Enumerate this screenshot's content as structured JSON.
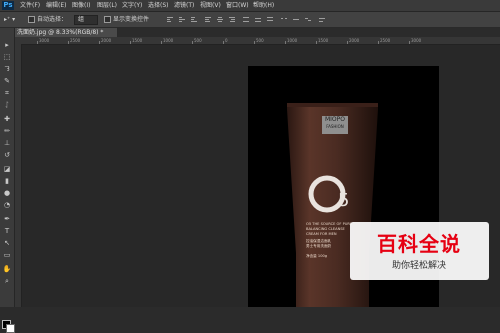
{
  "app": {
    "logo": "Ps"
  },
  "menu": [
    "文件(F)",
    "编辑(E)",
    "图像(I)",
    "图层(L)",
    "文字(Y)",
    "选择(S)",
    "滤镜(T)",
    "视图(V)",
    "窗口(W)",
    "帮助(H)"
  ],
  "options": {
    "auto_select_label": "自动选择：",
    "auto_select_value": "组",
    "transform_label": "显示变换控件"
  },
  "document": {
    "tab_title": "洗面奶.jpg @ 8.33%(RGB/8) *"
  },
  "ruler": {
    "ticks": [
      "3000",
      "2500",
      "2000",
      "1500",
      "1000",
      "500",
      "0",
      "500",
      "1000",
      "1500",
      "2000",
      "2500",
      "3000"
    ]
  },
  "product": {
    "brand": "MIOPO",
    "brand_sub": "FASHION",
    "emblem": "O5",
    "lines": [
      "O5 THE SOURCE OF PURE",
      "BALANCING CLEANSE",
      "CREAM FOR MEN",
      "控油保湿洁面乳",
      "男士专用洗面奶",
      "净含量 100g"
    ]
  },
  "watermark": {
    "title": "百科全说",
    "subtitle": "助你轻松解决"
  },
  "colors": {
    "foreground": "#000000",
    "background": "#ffffff",
    "tube": "#4a2b22"
  }
}
